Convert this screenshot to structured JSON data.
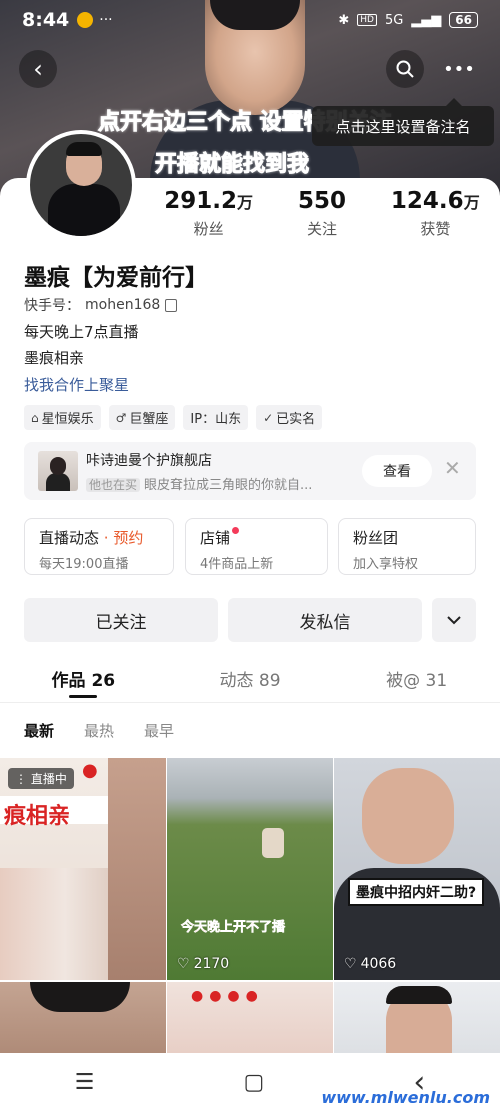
{
  "status_bar": {
    "time": "8:44",
    "battery": "66",
    "network": "5G",
    "dots": "···"
  },
  "cover": {
    "overlay_line1": "点开右边三个点 设置特别关注",
    "overlay_line2": "开播就能找到我",
    "tooltip": "点击这里设置备注名"
  },
  "profile": {
    "name": "墨痕【为爱前行】",
    "kuaishou_id_label": "快手号：",
    "kuaishou_id": "mohen168",
    "bio_lines": [
      "每天晚上7点直播",
      "墨痕相亲"
    ],
    "link_text": "找我合作上聚星",
    "tags": [
      {
        "icon": "building-icon",
        "glyph": "⌂",
        "label": "星恒娱乐"
      },
      {
        "icon": "male-icon",
        "glyph": "♂",
        "label": "巨蟹座"
      },
      {
        "icon": "ip-icon",
        "glyph": "",
        "label": "IP：山东"
      },
      {
        "icon": "verified-shield-icon",
        "glyph": "✓",
        "label": "已实名"
      }
    ]
  },
  "stats": [
    {
      "value": "291.2",
      "unit": "万",
      "label": "粉丝"
    },
    {
      "value": "550",
      "unit": "",
      "label": "关注"
    },
    {
      "value": "124.6",
      "unit": "万",
      "label": "获赞"
    }
  ],
  "shop": {
    "title": "咔诗迪曼个护旗舰店",
    "pill": "他也在买",
    "subtitle": "眼皮耷拉成三角眼的你就自...",
    "button": "查看"
  },
  "features": [
    {
      "title": "直播动态",
      "title_extra": " · 预约",
      "subtitle": "每天19:00直播"
    },
    {
      "title": "店铺",
      "title_extra": "",
      "subtitle": "4件商品上新"
    },
    {
      "title": "粉丝团",
      "title_extra": "",
      "subtitle": "加入享特权"
    }
  ],
  "actions": {
    "follow": "已关注",
    "message": "发私信",
    "more_icon": "chevron-down-icon"
  },
  "tabs": [
    {
      "label": "作品 26",
      "active": true
    },
    {
      "label": "动态 89",
      "active": false
    },
    {
      "label": "被@ 31",
      "active": false
    }
  ],
  "sorts": [
    "最新",
    "最热",
    "最早"
  ],
  "grid": {
    "live_badge": "直播中",
    "banner_text": "痕相亲",
    "likes_2": "2170",
    "field_caption": "今天晚上开不了播",
    "caption_3": "墨痕中招内奸二助?",
    "likes_3": "4066"
  },
  "navbar": {
    "menu": "☰",
    "home": "▢",
    "back": "‹"
  },
  "watermark": "www.mlwenlu.com"
}
